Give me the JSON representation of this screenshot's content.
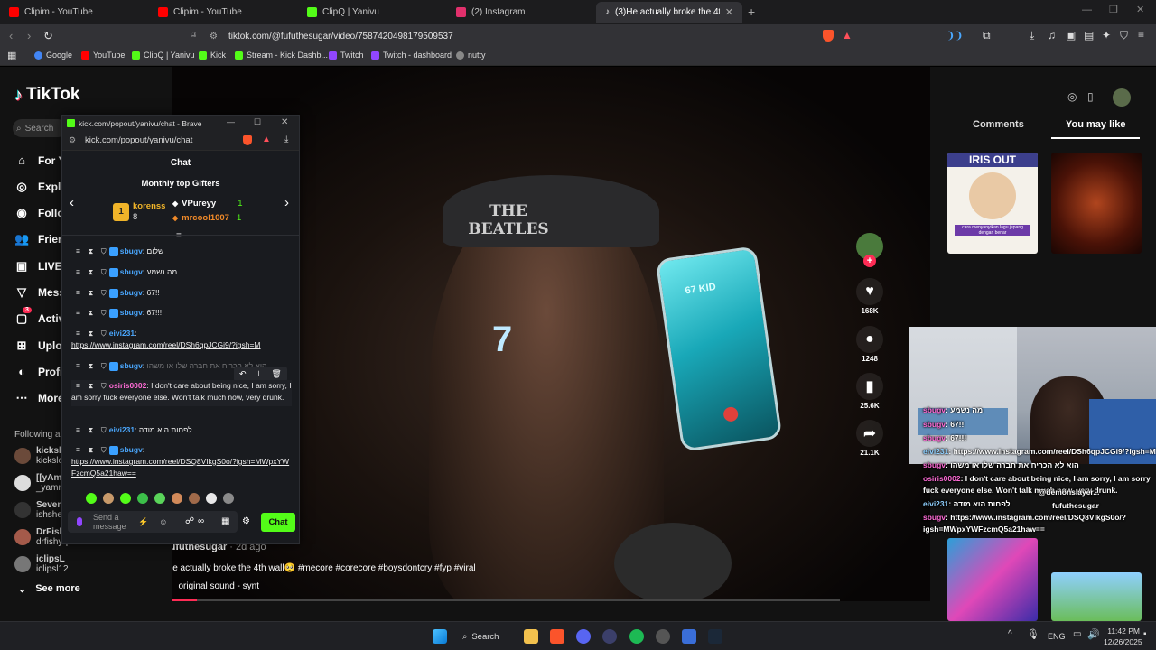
{
  "tabs": [
    {
      "title": "Clipim - YouTube",
      "color": "#ff0000"
    },
    {
      "title": "Clipim - YouTube",
      "color": "#ff0000"
    },
    {
      "title": "ClipQ | Yanivu",
      "color": "#53fc18"
    },
    {
      "title": "(2) Instagram",
      "color": "#e1306c"
    },
    {
      "title": "(3)He actually broke the 4th wal",
      "color": "#ffffff"
    }
  ],
  "new_tab": "+",
  "address": {
    "url": "tiktok.com/@fufuthesugar/video/7587420498179509537"
  },
  "bookmarks": [
    {
      "label": "Google",
      "color": "#4285f4"
    },
    {
      "label": "YouTube",
      "color": "#ff0000"
    },
    {
      "label": "ClipQ | Yanivu",
      "color": "#53fc18"
    },
    {
      "label": "Kick",
      "color": "#53fc18"
    },
    {
      "label": "Stream - Kick Dashb...",
      "color": "#53fc18"
    },
    {
      "label": "Twitch",
      "color": "#9146ff"
    },
    {
      "label": "Twitch - dashboard",
      "color": "#9146ff"
    },
    {
      "label": "nutty",
      "color": "#888888"
    }
  ],
  "tiktok": {
    "logo": "TikTok",
    "search_placeholder": "Search",
    "nav": [
      {
        "label": "For Y",
        "icon": "home-icon"
      },
      {
        "label": "Explo",
        "icon": "compass-icon"
      },
      {
        "label": "Follo",
        "icon": "following-icon"
      },
      {
        "label": "Frien",
        "icon": "friends-icon"
      },
      {
        "label": "LIVE",
        "icon": "live-icon"
      },
      {
        "label": "Mess",
        "icon": "message-icon"
      },
      {
        "label": "Activ",
        "icon": "activity-icon",
        "badge": "3"
      },
      {
        "label": "Uploa",
        "icon": "upload-icon"
      },
      {
        "label": "Profi",
        "icon": "profile-icon"
      },
      {
        "label": "More",
        "icon": "more-icon"
      }
    ],
    "following_label": "Following a",
    "following": [
      {
        "name": "kickslo",
        "sub": "kickslo"
      },
      {
        "name": "[[yAm]",
        "sub": "_yamm"
      },
      {
        "name": "Seven",
        "sub": "ishshe"
      },
      {
        "name": "DrFish",
        "sub": "drfishyq..."
      },
      {
        "name": "iclipsL",
        "sub": "iclipsl12"
      }
    ],
    "see_more": "See more",
    "video": {
      "author": "fufuthesugar",
      "age": "· 2d ago",
      "caption": "He actually broke the 4th wall🥺 #mecore #corecore #boysdontcry #fyp #viral",
      "sound": "original sound - synt",
      "cap_text": "THE BEATLES",
      "phone_text": "67 KID",
      "overlay_number": "7"
    },
    "actions": [
      {
        "icon": "heart-icon",
        "count": "168K"
      },
      {
        "icon": "comment-icon",
        "count": "1248"
      },
      {
        "icon": "bookmark-icon",
        "count": "25.6K"
      },
      {
        "icon": "share-icon",
        "count": "21.1K"
      }
    ],
    "right_tabs": {
      "comments": "Comments",
      "you_may_like": "You may like"
    },
    "thumb_title": "IRIS OUT",
    "thumb_caption": "cara menyanyikan lagu jepang dengan benar"
  },
  "chat_window": {
    "title": "kick.com/popout/yanivu/chat - Brave",
    "url": "kick.com/popout/yanivu/chat",
    "heading": "Chat",
    "gifters_title": "Monthly top Gifters",
    "gifters": [
      {
        "rank": "1",
        "name": "korenss",
        "count": "8"
      },
      {
        "rank": "",
        "name": "VPureyy",
        "count": "1"
      },
      {
        "rank": "",
        "name": "mrcool1007",
        "count": "1"
      }
    ],
    "messages": [
      {
        "user": "sbugv",
        "text": "שלום",
        "color": "#4aa8ff"
      },
      {
        "user": "sbugv",
        "text": "מה נשמע",
        "color": "#4aa8ff"
      },
      {
        "user": "sbugv",
        "text": "67!!",
        "color": "#4aa8ff"
      },
      {
        "user": "sbugv",
        "text": "67!!!",
        "color": "#4aa8ff"
      },
      {
        "user": "eivi231",
        "text": "https://www.instagram.com/reel/DSh6qpJCGi9/?igsh=M",
        "color": "#4aa8ff"
      },
      {
        "user": "sbugv",
        "text": "הוא לא הכריח את חברה שלו או משהו",
        "color": "#4aa8ff"
      },
      {
        "user": "osiris0002",
        "text": "I don't care about being nice, I am sorry, I am sorry fuck everyone else. Won't talk much now, very drunk.",
        "color": "#ff6bd6"
      },
      {
        "user": "eivi231",
        "text": "לפחות הוא מודה",
        "color": "#4aa8ff"
      },
      {
        "user": "sbugv",
        "text": "https://www.instagram.com/reel/DSQ8VIkgS0o/?igsh=MWpxYWFzcmQ5a21haw==",
        "color": "#4aa8ff"
      }
    ],
    "input_placeholder": "Send a message",
    "send_label": "Chat"
  },
  "stream_overlay": {
    "lines": [
      {
        "user": "sbugv",
        "text": ": מה נשמע"
      },
      {
        "user": "sbugv",
        "text": ": 67!!"
      },
      {
        "user": "sbugv",
        "text": ": 67!!!"
      },
      {
        "user": "eivi231",
        "text": ": https://www.instagram.com/reel/DSh6qpJCGi9/?igsh=M"
      },
      {
        "user": "sbugv",
        "text": ": הוא לא הכריח את חברה שלו או משהו"
      },
      {
        "user": "osiris0002",
        "text": ": I don't care about being nice, I am sorry, I am sorry"
      },
      {
        "user": "",
        "text": "fuck everyone else. Won't talk much now, very drunk."
      },
      {
        "user": "eivi231",
        "text": ": לפחות הוא מודה"
      },
      {
        "user": "sbugv",
        "text": ": https://www.instagram.com/reel/DSQ8VIkgS0o/?"
      },
      {
        "user": "",
        "text": "igsh=MWpxYWFzcmQ5a21haw=="
      }
    ],
    "tiktok_tag": "@demonslayer...",
    "tiktok_user": "fufuthesugar"
  },
  "taskbar": {
    "search": "Search",
    "lang": "ENG",
    "time": "11:42 PM",
    "date": "12/26/2025"
  }
}
